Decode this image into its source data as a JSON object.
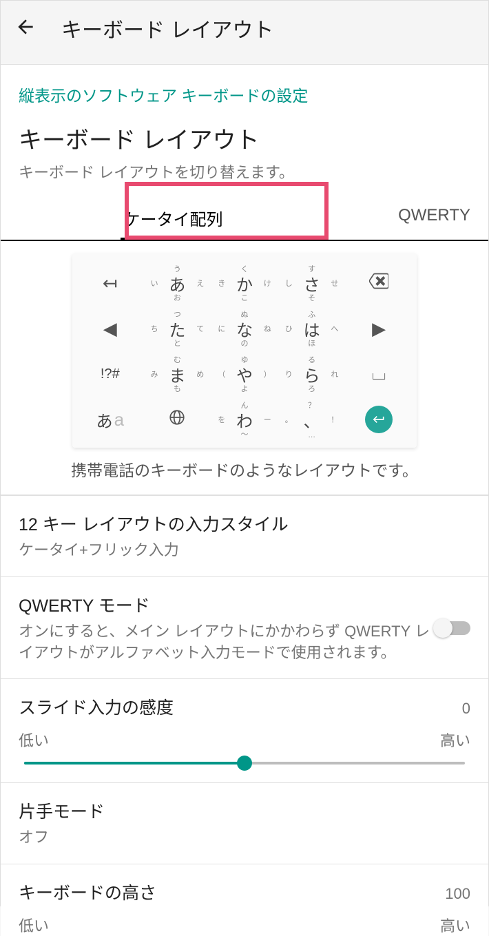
{
  "header": {
    "title": "キーボード レイアウト"
  },
  "section": {
    "label": "縦表示のソフトウェア キーボードの設定",
    "title": "キーボード レイアウト",
    "subtitle": "キーボード レイアウトを切り替えます。"
  },
  "tabs": {
    "t0": "ケータイ配列",
    "t1": "QWERTY"
  },
  "keys": {
    "a": {
      "main": "あ",
      "top": "う",
      "bot": "お",
      "left": "い",
      "right": "え"
    },
    "ka": {
      "main": "か",
      "top": "く",
      "bot": "こ",
      "left": "き",
      "right": "け"
    },
    "sa": {
      "main": "さ",
      "top": "す",
      "bot": "そ",
      "left": "し",
      "right": "せ"
    },
    "ta": {
      "main": "た",
      "top": "つ",
      "bot": "と",
      "left": "ち",
      "right": "て"
    },
    "na": {
      "main": "な",
      "top": "ぬ",
      "bot": "の",
      "left": "に",
      "right": "ね"
    },
    "ha": {
      "main": "は",
      "top": "ふ",
      "bot": "ほ",
      "left": "ひ",
      "right": "へ"
    },
    "ma": {
      "main": "ま",
      "top": "む",
      "bot": "も",
      "left": "み",
      "right": "め"
    },
    "ya": {
      "main": "や",
      "top": "ゆ",
      "bot": "よ",
      "left": "（",
      "right": "）"
    },
    "ra": {
      "main": "ら",
      "top": "る",
      "bot": "ろ",
      "left": "り",
      "right": "れ"
    },
    "wa": {
      "main": "わ",
      "top": "ん",
      "bot": "〜",
      "left": "を",
      "right": "ー"
    },
    "punct": {
      "main": "、",
      "top": "？",
      "bot": "…",
      "left": "。",
      "right": "！"
    },
    "sym": "!?#",
    "mode_a": "あ",
    "mode_a2": "a"
  },
  "preview_caption": "携帯電話のキーボードのようなレイアウトです。",
  "items": {
    "style": {
      "title": "12 キー レイアウトの入力スタイル",
      "sub": "ケータイ+フリック入力"
    },
    "qwerty": {
      "title": "QWERTY モード",
      "sub": "オンにすると、メイン レイアウトにかかわらず QWERTY レイアウトがアルファベット入力モードで使用されます。"
    },
    "slide": {
      "title": "スライド入力の感度",
      "value": "0",
      "low": "低い",
      "high": "高い"
    },
    "onehand": {
      "title": "片手モード",
      "sub": "オフ"
    },
    "height": {
      "title": "キーボードの高さ",
      "value": "100",
      "low": "低い",
      "high": "高い"
    }
  }
}
